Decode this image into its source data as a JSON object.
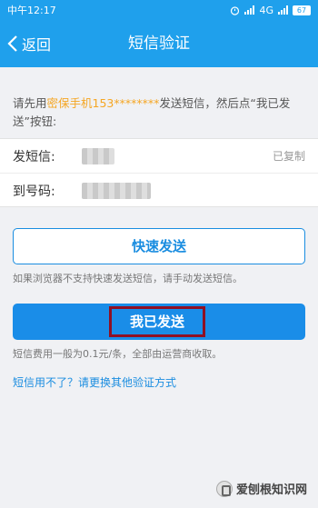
{
  "status_bar": {
    "carrier_time": "中午12:17",
    "network": "4G",
    "battery": "67"
  },
  "nav": {
    "back_label": "返回",
    "title": "短信验证"
  },
  "instructions": {
    "prefix": "请先用",
    "highlight": "密保手机153********",
    "suffix": "发送短信，然后点“我已发送”按钮:"
  },
  "form": {
    "sms_label": "发短信:",
    "copied_label": "已复制",
    "number_label": "到号码:"
  },
  "quick_send_label": "快速发送",
  "quick_send_hint": "如果浏览器不支持快速发送短信，请手动发送短信。",
  "sent_label": "我已发送",
  "fee_hint": "短信费用一般为0.1元/条，全部由运营商收取。",
  "alt_link": "短信用不了？请更换其他验证方式",
  "watermark": "爱刨根知识网",
  "colors": {
    "bar": "#1fa0ec",
    "primary": "#1a8de8",
    "highlight": "#f5a623",
    "annotation_box": "#8f1024"
  }
}
